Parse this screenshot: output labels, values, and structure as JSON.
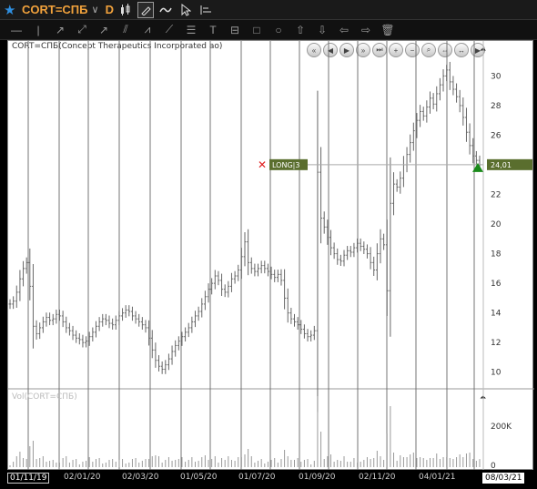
{
  "topbar": {
    "symbol": "CORT=СПБ",
    "period": "D"
  },
  "chart": {
    "title": "CORT=СПБ(Concept Therapeutics Incorporated ao)",
    "volume_label": "Vol(CORT=СПБ)",
    "order_label": "LONG|3",
    "price_label": "24,01",
    "y_ticks": [
      "30",
      "28",
      "26",
      "24",
      "22",
      "20",
      "18",
      "16",
      "14",
      "12",
      "10"
    ],
    "vol_ticks": [
      "200K",
      "0"
    ],
    "date_start": "01/11/19",
    "date_end": "08/03/21",
    "x_labels": [
      "02/01/20",
      "02/03/20",
      "01/05/20",
      "01/07/20",
      "01/09/20",
      "02/11/20",
      "04/01/21"
    ]
  },
  "chart_data": {
    "type": "bar",
    "description_free": true,
    "x_range": [
      "01/11/19",
      "08/03/21"
    ],
    "ylim": [
      9,
      31.5
    ],
    "price_last": 24.01,
    "series": [
      {
        "values": [
          14.6,
          14.8,
          15.4,
          16.3,
          17.0,
          17.4,
          15.8,
          13.1,
          12.6,
          13.0,
          13.4,
          13.7,
          13.5,
          13.6,
          13.9,
          13.8,
          13.4,
          13.0,
          12.8,
          12.5,
          12.3,
          12.2,
          12.0,
          12.1,
          12.4,
          12.7,
          13.1,
          13.4,
          13.6,
          13.5,
          13.3,
          13.2,
          13.5,
          13.8,
          14.0,
          14.2,
          14.1,
          13.8,
          13.6,
          13.4,
          13.2,
          13.0,
          12.3,
          11.5,
          10.8,
          10.4,
          10.2,
          10.5,
          10.9,
          11.4,
          11.8,
          12.1,
          12.4,
          12.7,
          13.0,
          13.4,
          13.8,
          14.1,
          14.6,
          15.1,
          15.6,
          16.0,
          16.5,
          16.2,
          15.6,
          15.4,
          15.8,
          16.3,
          16.5,
          16.9,
          17.8,
          18.8,
          17.4,
          17.0,
          16.8,
          17.0,
          17.2,
          17.0,
          16.8,
          16.6,
          16.4,
          16.6,
          16.2,
          15.0,
          14.0,
          13.6,
          13.4,
          13.2,
          12.9,
          12.6,
          12.4,
          12.5,
          12.8,
          23.5,
          20.4,
          19.8,
          19.1,
          18.4,
          18.0,
          17.6,
          17.5,
          17.9,
          18.2,
          18.1,
          18.4,
          18.7,
          18.5,
          18.3,
          18.0,
          17.4,
          16.9,
          18.0,
          19.0,
          18.6,
          15.5,
          21.4,
          22.7,
          22.5,
          23.1,
          24.0,
          24.7,
          25.5,
          26.3,
          27.0,
          27.6,
          27.3,
          27.9,
          28.5,
          28.1,
          28.8,
          29.4,
          30.0,
          30.4,
          29.6,
          29.1,
          28.6,
          28.0,
          27.2,
          26.2,
          25.3,
          24.6,
          24.3,
          24.01
        ]
      }
    ]
  }
}
